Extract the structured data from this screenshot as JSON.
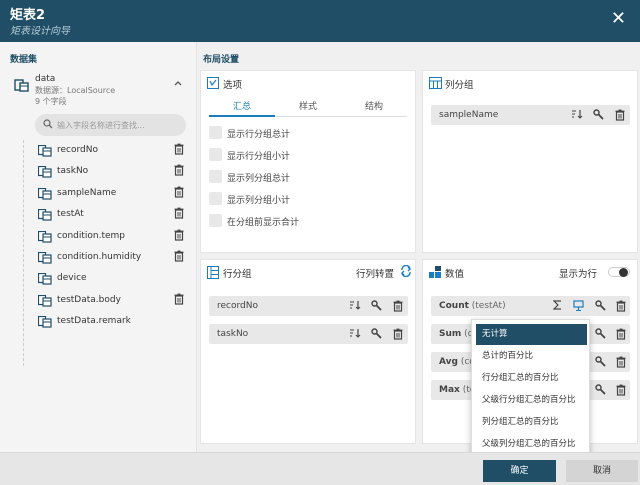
{
  "dialog": {
    "title": "矩表2",
    "subtitle": "矩表设计向导"
  },
  "datasets": {
    "section_label": "数据集",
    "source": {
      "name": "data",
      "source_text": "数据源：LocalSource",
      "count_text": "9 个字段"
    },
    "search_placeholder": "输入字段名称进行查找...",
    "fields": [
      {
        "label": "recordNo",
        "deletable": true
      },
      {
        "label": "taskNo",
        "deletable": true
      },
      {
        "label": "sampleName",
        "deletable": true
      },
      {
        "label": "testAt",
        "deletable": true
      },
      {
        "label": "condition.temp",
        "deletable": true
      },
      {
        "label": "condition.humidity",
        "deletable": true
      },
      {
        "label": "device",
        "deletable": false
      },
      {
        "label": "testData.body",
        "deletable": true
      },
      {
        "label": "testData.remark",
        "deletable": false
      }
    ]
  },
  "layout": {
    "section_label": "布局设置",
    "options": {
      "title": "选项",
      "tabs": [
        "汇总",
        "样式",
        "结构"
      ],
      "active_tab": "汇总",
      "checkboxes": [
        "显示行分组总计",
        "显示行分组小计",
        "显示列分组总计",
        "显示列分组小计",
        "在分组前显示合计"
      ]
    },
    "column_groups": {
      "title": "列分组",
      "items": [
        "sampleName"
      ]
    },
    "row_groups": {
      "title": "行分组",
      "swap_label": "行列转置",
      "items": [
        "recordNo",
        "taskNo"
      ]
    },
    "values": {
      "title": "数值",
      "show_as_row_label": "显示为行",
      "items": [
        {
          "agg": "Count",
          "field": " (testAt)"
        },
        {
          "agg": "Sum",
          "field": " (con"
        },
        {
          "agg": "Avg",
          "field": " (con"
        },
        {
          "agg": "Max",
          "field": " (tes"
        }
      ]
    }
  },
  "context_menu": {
    "items": [
      "无计算",
      "总计的百分比",
      "行分组汇总的百分比",
      "父级行分组汇总的百分比",
      "列分组汇总的百分比",
      "父级列分组汇总的百分比"
    ],
    "active_index": 0
  },
  "footer": {
    "ok_label": "确定",
    "cancel_label": "取消"
  },
  "colors": {
    "header": "#1f4e66",
    "accent": "#1a7dc3"
  }
}
